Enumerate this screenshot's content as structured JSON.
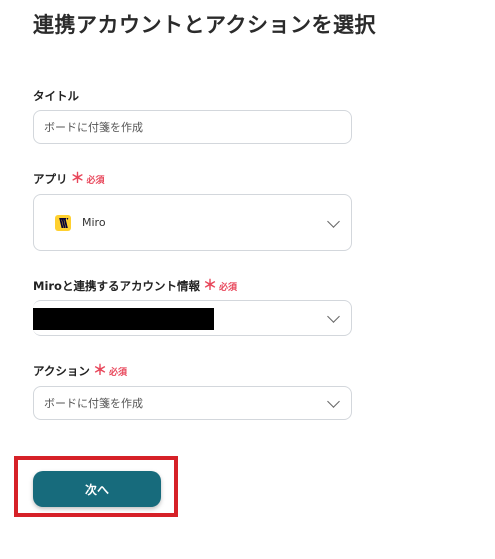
{
  "page": {
    "title": "連携アカウントとアクションを選択"
  },
  "fields": {
    "title": {
      "label": "タイトル",
      "value": "ボードに付箋を作成"
    },
    "app": {
      "label": "アプリ",
      "required_mark": "＊",
      "required_text": "必須",
      "value": "Miro",
      "icon": "miro-logo-icon"
    },
    "account": {
      "label": "Miroと連携するアカウント情報",
      "required_mark": "＊",
      "required_text": "必須"
    },
    "action": {
      "label": "アクション",
      "required_mark": "＊",
      "required_text": "必須",
      "value": "ボードに付箋を作成"
    }
  },
  "buttons": {
    "next_label": "次へ"
  },
  "colors": {
    "accent": "#176b7c",
    "required": "#e8475b",
    "highlight": "#d62128",
    "miro_brand": "#ffd02f"
  }
}
